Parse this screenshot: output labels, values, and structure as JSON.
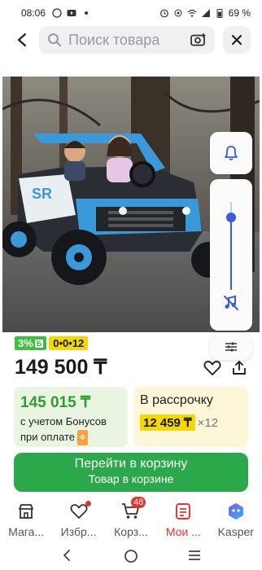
{
  "status_bar": {
    "time": "08:06",
    "battery": "69 %"
  },
  "search": {
    "placeholder": "Поиск товара"
  },
  "product": {
    "badge_bonus": "3%",
    "badge_bonus_mark": "Б",
    "badge_installment": "0•0•12",
    "price": "149 500 ₸"
  },
  "volume": {
    "level": 0.82
  },
  "bonus_card": {
    "amount": "145 015 ₸",
    "note_line1": "с учетом Бонусов",
    "note_line2": "при оплате",
    "chip": "Ф"
  },
  "installment_card": {
    "title": "В рассрочку",
    "monthly": "12 459 ₸",
    "months": "×12"
  },
  "cart_button": {
    "label": "Перейти в корзину",
    "sublabel": "Товар в корзине"
  },
  "bottom_nav": {
    "items": [
      {
        "label": "Мага...",
        "icon": "store-icon"
      },
      {
        "label": "Избр...",
        "icon": "heart-icon"
      },
      {
        "label": "Корз...",
        "icon": "cart-icon",
        "badge": "48"
      },
      {
        "label": "Мои ...",
        "icon": "orders-icon"
      },
      {
        "label": "Kasper",
        "icon": "kasper-icon"
      }
    ]
  },
  "colors": {
    "green": "#2ba84a",
    "bonus_green": "#3fbf3f",
    "yellow": "#f4d800",
    "red": "#e5322d",
    "blue": "#3a5bdc"
  }
}
